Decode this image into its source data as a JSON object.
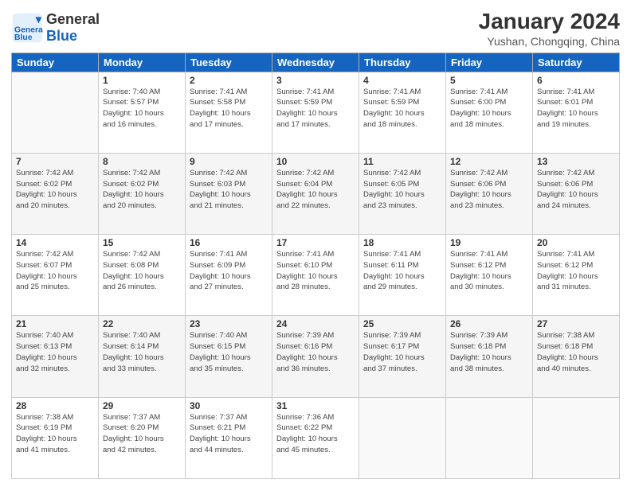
{
  "header": {
    "logo_general": "General",
    "logo_blue": "Blue",
    "month_title": "January 2024",
    "subtitle": "Yushan, Chongqing, China"
  },
  "columns": [
    "Sunday",
    "Monday",
    "Tuesday",
    "Wednesday",
    "Thursday",
    "Friday",
    "Saturday"
  ],
  "weeks": [
    [
      {
        "day": "",
        "details": ""
      },
      {
        "day": "1",
        "details": "Sunrise: 7:40 AM\nSunset: 5:57 PM\nDaylight: 10 hours\nand 16 minutes."
      },
      {
        "day": "2",
        "details": "Sunrise: 7:41 AM\nSunset: 5:58 PM\nDaylight: 10 hours\nand 17 minutes."
      },
      {
        "day": "3",
        "details": "Sunrise: 7:41 AM\nSunset: 5:59 PM\nDaylight: 10 hours\nand 17 minutes."
      },
      {
        "day": "4",
        "details": "Sunrise: 7:41 AM\nSunset: 5:59 PM\nDaylight: 10 hours\nand 18 minutes."
      },
      {
        "day": "5",
        "details": "Sunrise: 7:41 AM\nSunset: 6:00 PM\nDaylight: 10 hours\nand 18 minutes."
      },
      {
        "day": "6",
        "details": "Sunrise: 7:41 AM\nSunset: 6:01 PM\nDaylight: 10 hours\nand 19 minutes."
      }
    ],
    [
      {
        "day": "7",
        "details": "Sunrise: 7:42 AM\nSunset: 6:02 PM\nDaylight: 10 hours\nand 20 minutes."
      },
      {
        "day": "8",
        "details": "Sunrise: 7:42 AM\nSunset: 6:02 PM\nDaylight: 10 hours\nand 20 minutes."
      },
      {
        "day": "9",
        "details": "Sunrise: 7:42 AM\nSunset: 6:03 PM\nDaylight: 10 hours\nand 21 minutes."
      },
      {
        "day": "10",
        "details": "Sunrise: 7:42 AM\nSunset: 6:04 PM\nDaylight: 10 hours\nand 22 minutes."
      },
      {
        "day": "11",
        "details": "Sunrise: 7:42 AM\nSunset: 6:05 PM\nDaylight: 10 hours\nand 23 minutes."
      },
      {
        "day": "12",
        "details": "Sunrise: 7:42 AM\nSunset: 6:06 PM\nDaylight: 10 hours\nand 23 minutes."
      },
      {
        "day": "13",
        "details": "Sunrise: 7:42 AM\nSunset: 6:06 PM\nDaylight: 10 hours\nand 24 minutes."
      }
    ],
    [
      {
        "day": "14",
        "details": "Sunrise: 7:42 AM\nSunset: 6:07 PM\nDaylight: 10 hours\nand 25 minutes."
      },
      {
        "day": "15",
        "details": "Sunrise: 7:42 AM\nSunset: 6:08 PM\nDaylight: 10 hours\nand 26 minutes."
      },
      {
        "day": "16",
        "details": "Sunrise: 7:41 AM\nSunset: 6:09 PM\nDaylight: 10 hours\nand 27 minutes."
      },
      {
        "day": "17",
        "details": "Sunrise: 7:41 AM\nSunset: 6:10 PM\nDaylight: 10 hours\nand 28 minutes."
      },
      {
        "day": "18",
        "details": "Sunrise: 7:41 AM\nSunset: 6:11 PM\nDaylight: 10 hours\nand 29 minutes."
      },
      {
        "day": "19",
        "details": "Sunrise: 7:41 AM\nSunset: 6:12 PM\nDaylight: 10 hours\nand 30 minutes."
      },
      {
        "day": "20",
        "details": "Sunrise: 7:41 AM\nSunset: 6:12 PM\nDaylight: 10 hours\nand 31 minutes."
      }
    ],
    [
      {
        "day": "21",
        "details": "Sunrise: 7:40 AM\nSunset: 6:13 PM\nDaylight: 10 hours\nand 32 minutes."
      },
      {
        "day": "22",
        "details": "Sunrise: 7:40 AM\nSunset: 6:14 PM\nDaylight: 10 hours\nand 33 minutes."
      },
      {
        "day": "23",
        "details": "Sunrise: 7:40 AM\nSunset: 6:15 PM\nDaylight: 10 hours\nand 35 minutes."
      },
      {
        "day": "24",
        "details": "Sunrise: 7:39 AM\nSunset: 6:16 PM\nDaylight: 10 hours\nand 36 minutes."
      },
      {
        "day": "25",
        "details": "Sunrise: 7:39 AM\nSunset: 6:17 PM\nDaylight: 10 hours\nand 37 minutes."
      },
      {
        "day": "26",
        "details": "Sunrise: 7:39 AM\nSunset: 6:18 PM\nDaylight: 10 hours\nand 38 minutes."
      },
      {
        "day": "27",
        "details": "Sunrise: 7:38 AM\nSunset: 6:18 PM\nDaylight: 10 hours\nand 40 minutes."
      }
    ],
    [
      {
        "day": "28",
        "details": "Sunrise: 7:38 AM\nSunset: 6:19 PM\nDaylight: 10 hours\nand 41 minutes."
      },
      {
        "day": "29",
        "details": "Sunrise: 7:37 AM\nSunset: 6:20 PM\nDaylight: 10 hours\nand 42 minutes."
      },
      {
        "day": "30",
        "details": "Sunrise: 7:37 AM\nSunset: 6:21 PM\nDaylight: 10 hours\nand 44 minutes."
      },
      {
        "day": "31",
        "details": "Sunrise: 7:36 AM\nSunset: 6:22 PM\nDaylight: 10 hours\nand 45 minutes."
      },
      {
        "day": "",
        "details": ""
      },
      {
        "day": "",
        "details": ""
      },
      {
        "day": "",
        "details": ""
      }
    ]
  ]
}
